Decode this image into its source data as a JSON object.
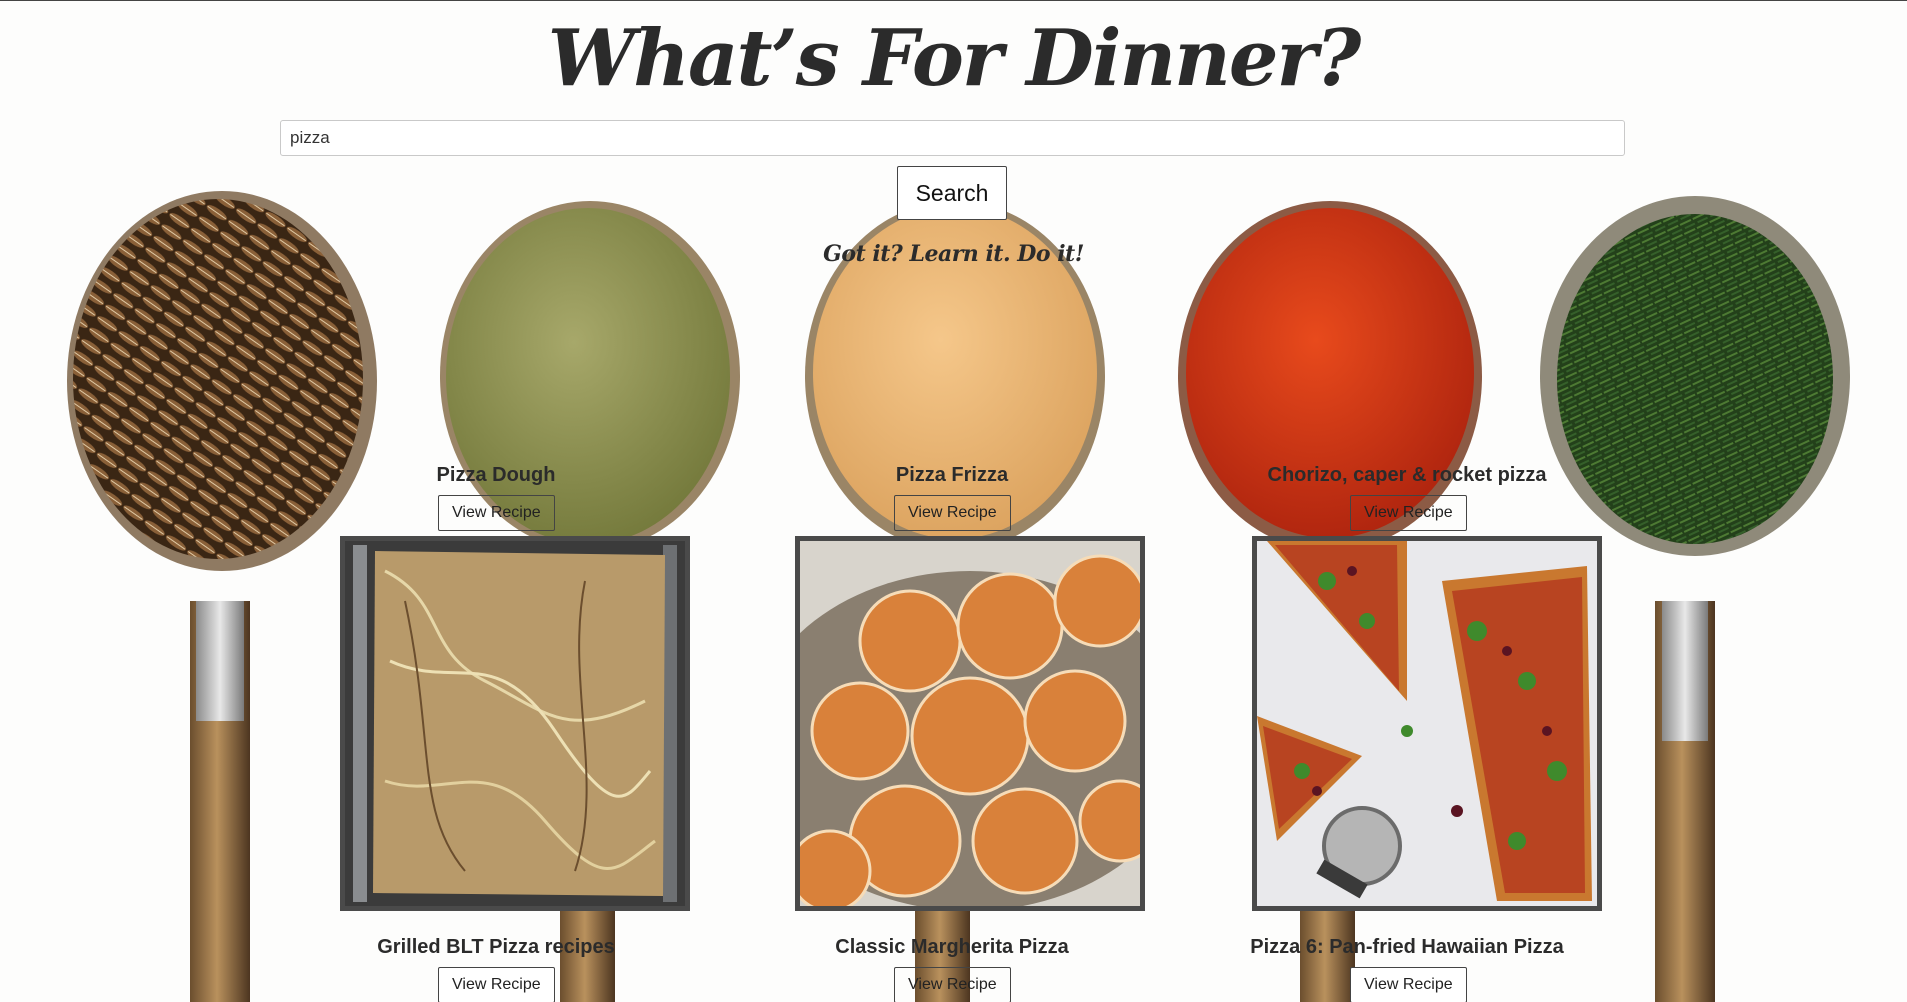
{
  "header": {
    "title": "What’s For Dinner?",
    "tagline": "Got it? Learn it. Do it!"
  },
  "search": {
    "value": "pizza",
    "button_label": "Search"
  },
  "background": {
    "spices": [
      "cumin-seeds",
      "green-powder",
      "yellow-powder",
      "red-paprika",
      "dried-herbs"
    ]
  },
  "results": [
    {
      "title": "Pizza Dough",
      "button": "View Recipe"
    },
    {
      "title": "Pizza Frizza",
      "button": "View Recipe"
    },
    {
      "title": "Chorizo, caper & rocket pizza",
      "button": "View Recipe"
    },
    {
      "title": "Grilled BLT Pizza recipes",
      "button": "View Recipe"
    },
    {
      "title": "Classic Margherita Pizza",
      "button": "View Recipe"
    },
    {
      "title": "Pizza 6: Pan-fried Hawaiian Pizza",
      "button": "View Recipe"
    }
  ],
  "images": [
    {
      "subject": "grilled-flatbread-pizza"
    },
    {
      "subject": "sugared-doughnut-balls"
    },
    {
      "subject": "chorizo-rocket-pizza"
    }
  ]
}
